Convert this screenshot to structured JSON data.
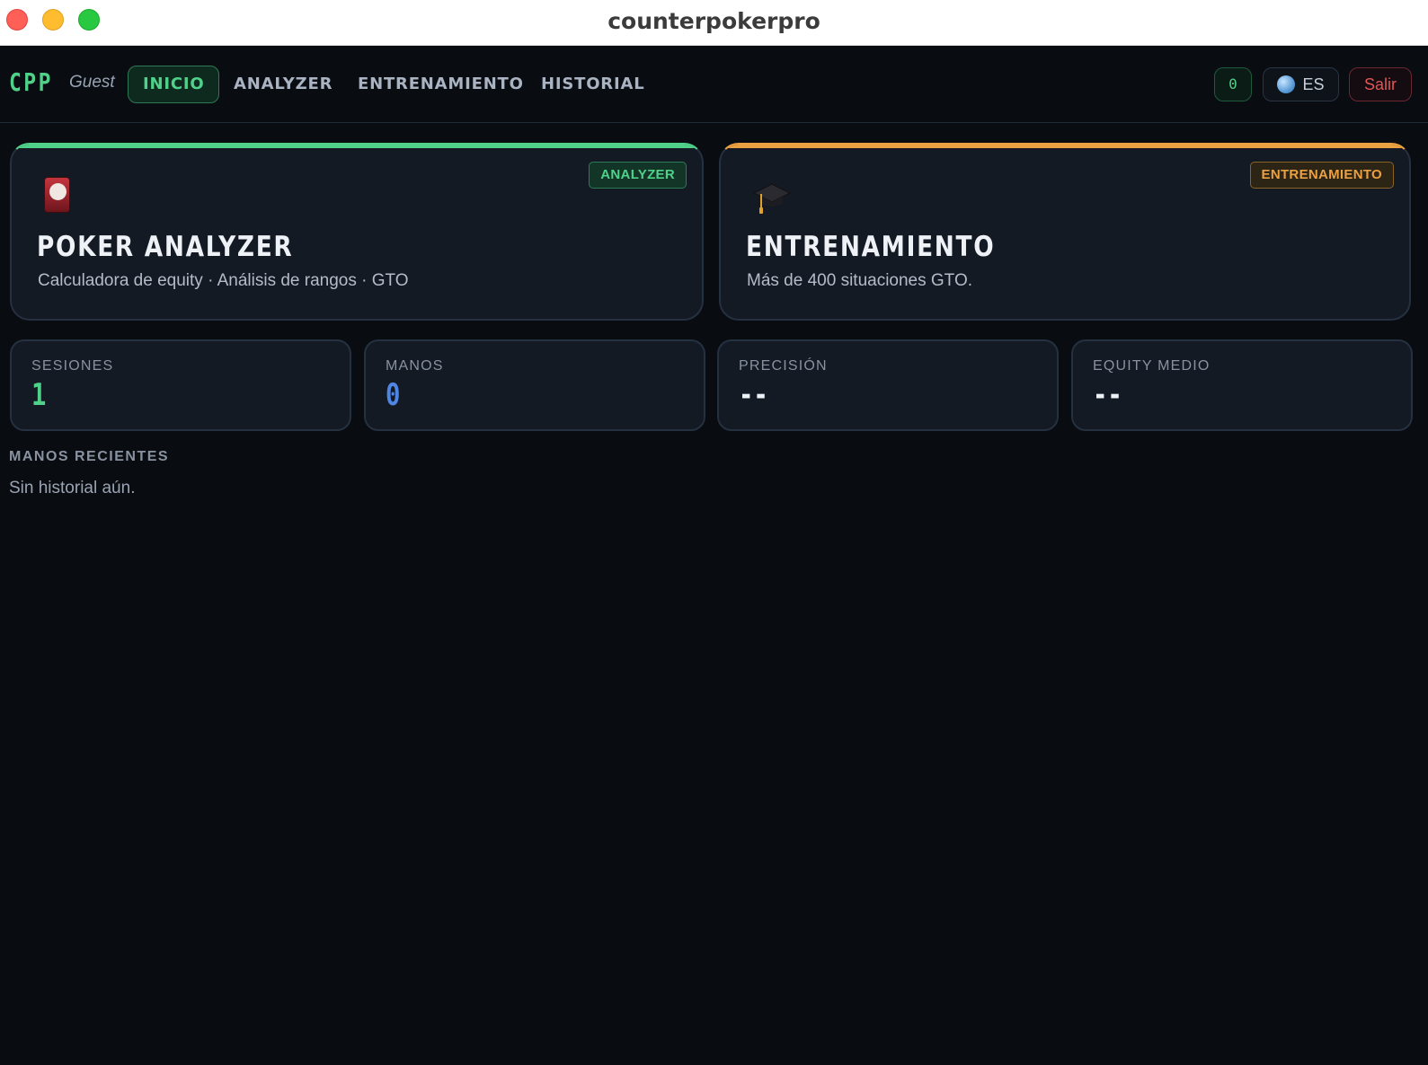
{
  "window": {
    "title": "counterpokerpro"
  },
  "nav": {
    "logo": "CPP",
    "user": "Guest",
    "tabs": [
      "INICIO",
      "ANALYZER",
      "ENTRENAMIENTO",
      "HISTORIAL"
    ],
    "counter": "0",
    "language": "ES",
    "logout": "Salir"
  },
  "cards": [
    {
      "tag": "ANALYZER",
      "icon": "playing-card-icon",
      "title": "POKER ANALYZER",
      "subtitle": "Calculadora de equity · Análisis de rangos · GTO",
      "accent": "#4fd18a"
    },
    {
      "tag": "ENTRENAMIENTO",
      "icon": "graduation-cap-icon",
      "title": "ENTRENAMIENTO",
      "subtitle": "Más de 400 situaciones GTO.",
      "accent": "#eba041"
    }
  ],
  "stats": [
    {
      "label": "SESIONES",
      "value": "1",
      "color": "#4fd18a"
    },
    {
      "label": "MANOS",
      "value": "0",
      "color": "#4f86e6"
    },
    {
      "label": "PRECISIÓN",
      "value": "--",
      "color": "#eef1f5"
    },
    {
      "label": "EQUITY MEDIO",
      "value": "--",
      "color": "#eef1f5"
    }
  ],
  "recent": {
    "title": "MANOS RECIENTES",
    "empty": "Sin historial aún."
  }
}
